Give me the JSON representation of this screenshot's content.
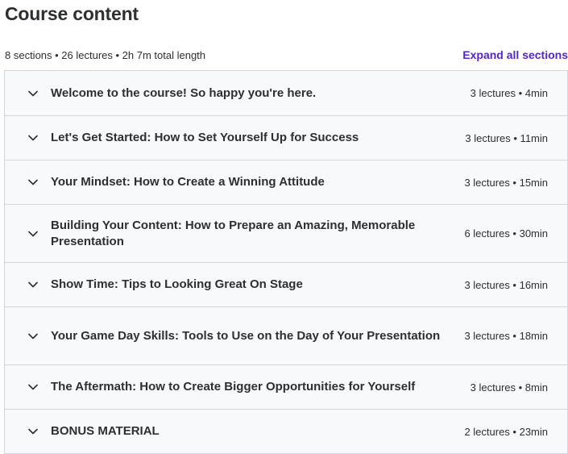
{
  "header": {
    "title": "Course content",
    "summary": "8 sections • 26 lectures • 2h 7m total length",
    "expand_all_label": "Expand all sections"
  },
  "icons": {
    "section_toggle": "chevron-down-icon"
  },
  "colors": {
    "accent": "#5624d0",
    "text": "#2d2f31",
    "section_bg": "#f7f9fa",
    "border": "#d1d7dc"
  },
  "sections": [
    {
      "title": "Welcome to the course! So happy you're here.",
      "meta": "3 lectures • 4min"
    },
    {
      "title": "Let's Get Started: How to Set Yourself Up for Success",
      "meta": "3 lectures • 11min"
    },
    {
      "title": "Your Mindset: How to Create a Winning Attitude",
      "meta": "3 lectures • 15min"
    },
    {
      "title": "Building Your Content: How to Prepare an Amazing, Memorable Presentation",
      "meta": "6 lectures • 30min"
    },
    {
      "title": "Show Time: Tips to Looking Great On Stage",
      "meta": "3 lectures • 16min"
    },
    {
      "title": "Your Game Day Skills: Tools to Use on the Day of Your Presentation",
      "meta": "3 lectures • 18min"
    },
    {
      "title": "The Aftermath: How to Create Bigger Opportunities for Yourself",
      "meta": "3 lectures • 8min"
    },
    {
      "title": "BONUS MATERIAL",
      "meta": "2 lectures • 23min"
    }
  ]
}
